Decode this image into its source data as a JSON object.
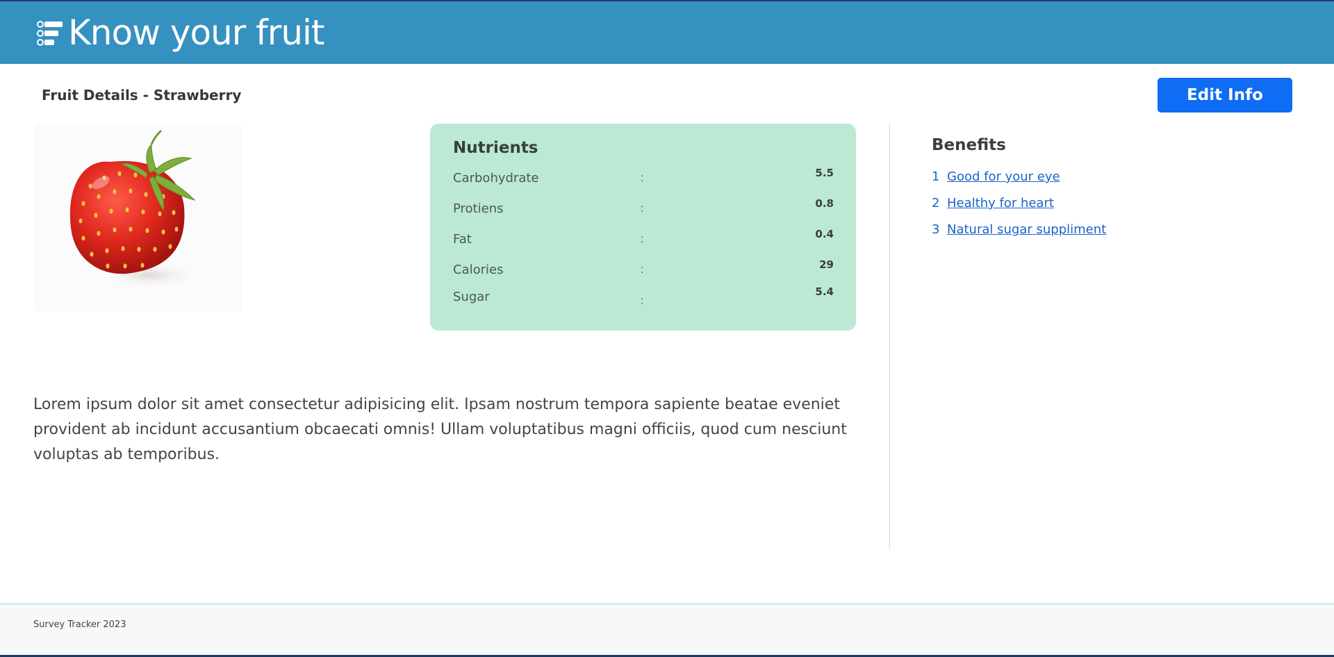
{
  "header": {
    "app_title": "Know your fruit",
    "logo_icon": "checklist-icon",
    "background_color": "#3591bf"
  },
  "page": {
    "heading": "Fruit Details - Strawberry",
    "edit_button_label": "Edit Info",
    "accent_color": "#0f6cf5"
  },
  "fruit": {
    "name": "Strawberry",
    "image_icon": "strawberry-image"
  },
  "nutrients": {
    "title": "Nutrients",
    "separator": ":",
    "card_color": "#bbe9d3",
    "items": [
      {
        "label": "Carbohydrate",
        "value": "5.5"
      },
      {
        "label": "Protiens",
        "value": "0.8"
      },
      {
        "label": "Fat",
        "value": "0.4"
      },
      {
        "label": "Calories",
        "value": "29"
      },
      {
        "label": "Sugar",
        "value": "5.4"
      }
    ]
  },
  "benefits": {
    "title": "Benefits",
    "items": [
      {
        "number": "1",
        "label": "Good for your eye"
      },
      {
        "number": "2",
        "label": "Healthy for heart"
      },
      {
        "number": "3",
        "label": "Natural sugar suppliment"
      }
    ]
  },
  "description": "Lorem ipsum dolor sit amet consectetur adipisicing elit. Ipsam nostrum tempora sapiente beatae eveniet provident ab incidunt accusantium obcaecati omnis! Ullam voluptatibus magni officiis, quod cum nesciunt voluptas ab temporibus.",
  "footer": {
    "text": "Survey Tracker 2023"
  }
}
